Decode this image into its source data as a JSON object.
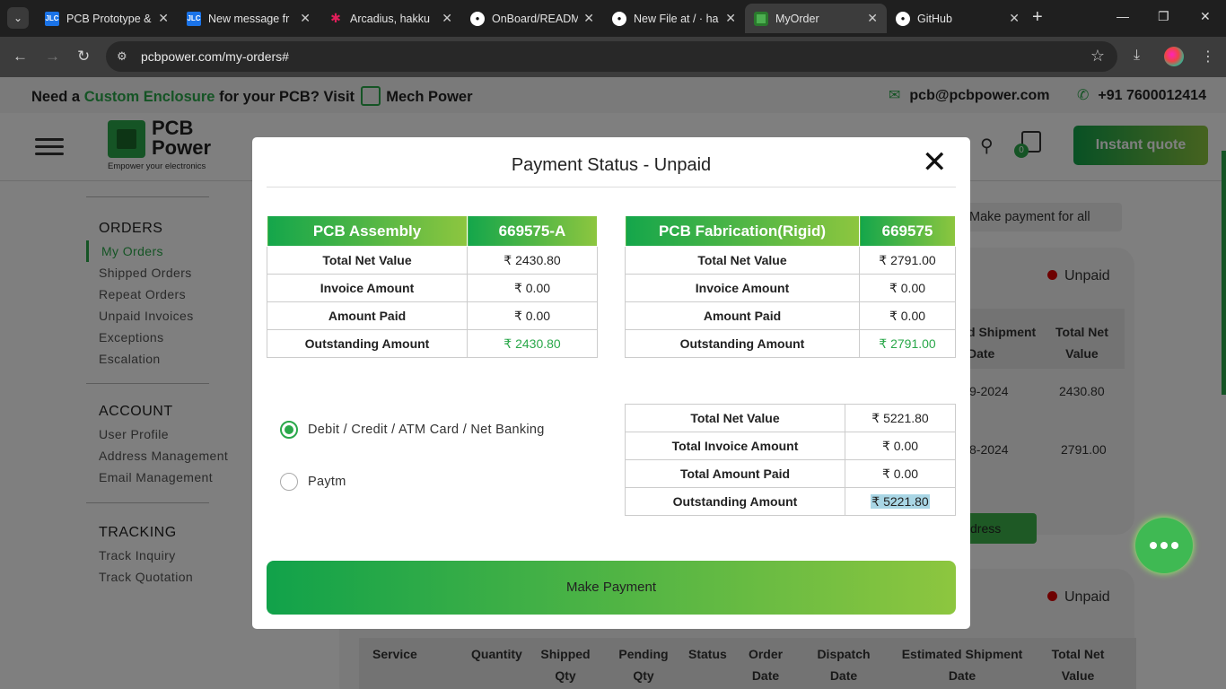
{
  "browser": {
    "tabs": [
      {
        "title": "PCB Prototype &",
        "icon": "jlc-favicon",
        "active": false
      },
      {
        "title": "New message fr",
        "icon": "jlc-favicon",
        "active": false
      },
      {
        "title": "Arcadius, hakku",
        "icon": "slack-favicon",
        "active": false
      },
      {
        "title": "OnBoard/READM",
        "icon": "github-favicon",
        "active": false
      },
      {
        "title": "New File at / · ha",
        "icon": "github-favicon",
        "active": false
      },
      {
        "title": "MyOrder",
        "icon": "pcbpower-favicon",
        "active": true
      },
      {
        "title": "GitHub",
        "icon": "github-favicon",
        "active": false
      }
    ],
    "url": "pcbpower.com/my-orders#"
  },
  "topstrip": {
    "need": "Need a",
    "custom_enclosure": "Custom Enclosure",
    "for_pcb": "for your PCB? Visit",
    "mech_power": "Mech Power",
    "email": "pcb@pcbpower.com",
    "phone": "+91 7600012414"
  },
  "header": {
    "logo_line1": "PCB",
    "logo_line2": "Power",
    "logo_tagline": "Empower your electronics",
    "cart_count": "0",
    "instant_quote": "Instant quote"
  },
  "sidebar": {
    "orders_heading": "ORDERS",
    "orders_items": [
      "My Orders",
      "Shipped Orders",
      "Repeat Orders",
      "Unpaid Invoices",
      "Exceptions",
      "Escalation"
    ],
    "account_heading": "ACCOUNT",
    "account_items": [
      "User Profile",
      "Address Management",
      "Email Management"
    ],
    "tracking_heading": "TRACKING",
    "tracking_items": [
      "Track Inquiry",
      "Track Quotation"
    ]
  },
  "background": {
    "make_payment_all": "Make payment for all",
    "status1": "Unpaid",
    "status2": "Unpaid",
    "col_est_ship": "d Shipment",
    "col_date": "Date",
    "col_total": "Total Net",
    "col_value": "Value",
    "row1_date": "9-2024",
    "row1_value": "2430.80",
    "row2_date": "8-2024",
    "row2_value": "2791.00",
    "address_btn": "dress",
    "table_headers": [
      "Service",
      "Quantity",
      "Shipped Qty",
      "Pending Qty",
      "Status",
      "Order Date",
      "Dispatch Date",
      "Estimated Shipment Date",
      "Total Net Value"
    ]
  },
  "modal": {
    "title": "Payment Status - Unpaid",
    "assembly": {
      "header_name": "PCB Assembly",
      "header_id": "669575-A",
      "rows": [
        {
          "label": "Total Net Value",
          "value": "₹ 2430.80"
        },
        {
          "label": "Invoice Amount",
          "value": "₹ 0.00"
        },
        {
          "label": "Amount Paid",
          "value": "₹ 0.00"
        },
        {
          "label": "Outstanding Amount",
          "value": "₹ 2430.80"
        }
      ]
    },
    "fabrication": {
      "header_name": "PCB Fabrication(Rigid)",
      "header_id": "669575",
      "rows": [
        {
          "label": "Total Net Value",
          "value": "₹ 2791.00"
        },
        {
          "label": "Invoice Amount",
          "value": "₹ 0.00"
        },
        {
          "label": "Amount Paid",
          "value": "₹ 0.00"
        },
        {
          "label": "Outstanding Amount",
          "value": "₹ 2791.00"
        }
      ]
    },
    "payment_methods": [
      {
        "label": "Debit / Credit / ATM Card / Net Banking",
        "selected": true
      },
      {
        "label": "Paytm",
        "selected": false
      }
    ],
    "summary": [
      {
        "label": "Total Net Value",
        "value": "₹ 5221.80"
      },
      {
        "label": "Total Invoice Amount",
        "value": "₹ 0.00"
      },
      {
        "label": "Total Amount Paid",
        "value": "₹ 0.00"
      },
      {
        "label": "Outstanding Amount",
        "value": "₹ 5221.80"
      }
    ],
    "make_payment": "Make Payment"
  },
  "colors": {
    "brand_green": "#2aa84a",
    "gradient_start": "#11a24a",
    "gradient_end": "#8dc63f",
    "unpaid_red": "#dd0000"
  }
}
